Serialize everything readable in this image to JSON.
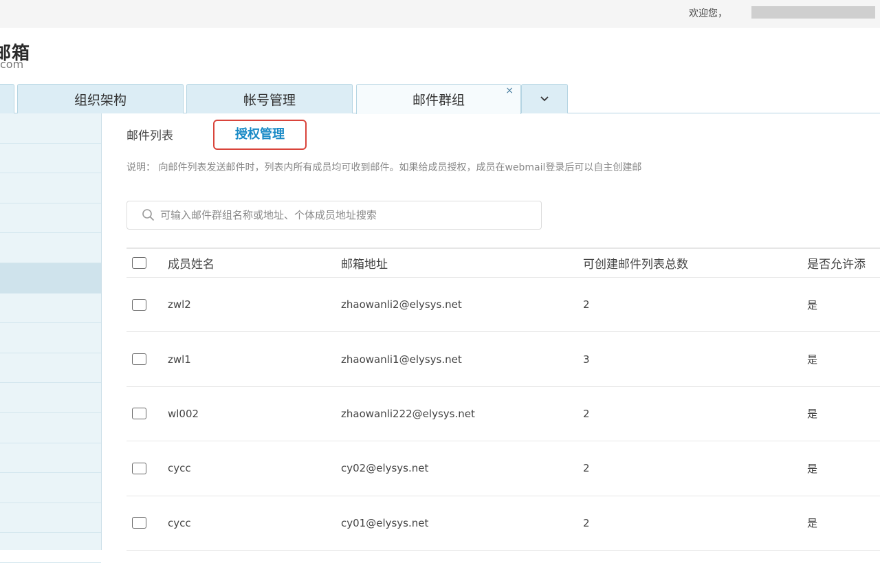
{
  "topbar": {
    "welcome": "欢迎您，"
  },
  "logo": {
    "title": "邮箱",
    "subtitle": "com"
  },
  "tabs": [
    {
      "label": "组织架构"
    },
    {
      "label": "帐号管理"
    },
    {
      "label": "邮件群组",
      "close_icon": "×"
    }
  ],
  "tab_more_icon": "chevron-down",
  "sidebar": {
    "item_count": 15,
    "active_index": 5
  },
  "subtabs": {
    "list": "邮件列表",
    "auth": "授权管理"
  },
  "note": "说明：  向邮件列表发送邮件时，列表内所有成员均可收到邮件。如果给成员授权，成员在webmail登录后可以自主创建邮",
  "search": {
    "placeholder": "可输入邮件群组名称或地址、个体成员地址搜索",
    "value": ""
  },
  "table": {
    "headers": {
      "name": "成员姓名",
      "email": "邮箱地址",
      "total": "可创建邮件列表总数",
      "allow": "是否允许添"
    },
    "rows": [
      {
        "name": "zwl2",
        "email": "zhaowanli2@elysys.net",
        "total": "2",
        "allow": "是"
      },
      {
        "name": "zwl1",
        "email": "zhaowanli1@elysys.net",
        "total": "3",
        "allow": "是"
      },
      {
        "name": "wl002",
        "email": "zhaowanli222@elysys.net",
        "total": "2",
        "allow": "是"
      },
      {
        "name": "cycc",
        "email": "cy02@elysys.net",
        "total": "2",
        "allow": "是"
      },
      {
        "name": "cycc",
        "email": "cy01@elysys.net",
        "total": "2",
        "allow": "是"
      }
    ]
  },
  "colors": {
    "accent": "#1a8ac6",
    "highlight_border": "#d9443b",
    "tab_bg": "#dcedf5",
    "sidebar_bg": "#eaf4f8"
  }
}
